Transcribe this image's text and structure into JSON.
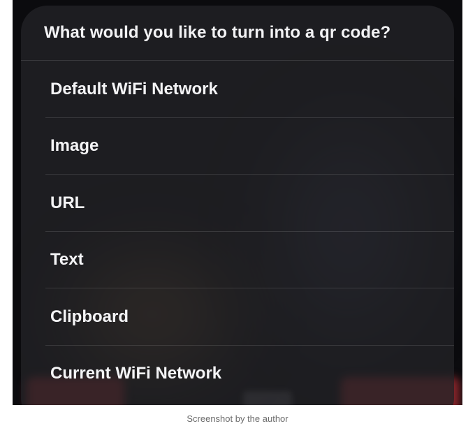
{
  "dialog": {
    "title": "What would you like to turn into a qr code?",
    "options": [
      {
        "label": "Default WiFi Network"
      },
      {
        "label": "Image"
      },
      {
        "label": "URL"
      },
      {
        "label": "Text"
      },
      {
        "label": "Clipboard"
      },
      {
        "label": "Current WiFi Network"
      }
    ]
  },
  "caption": "Screenshot by the author",
  "colors": {
    "sheet_background": "#222226",
    "text": "#f4f4f6",
    "caption_text": "#6b6b6b"
  }
}
